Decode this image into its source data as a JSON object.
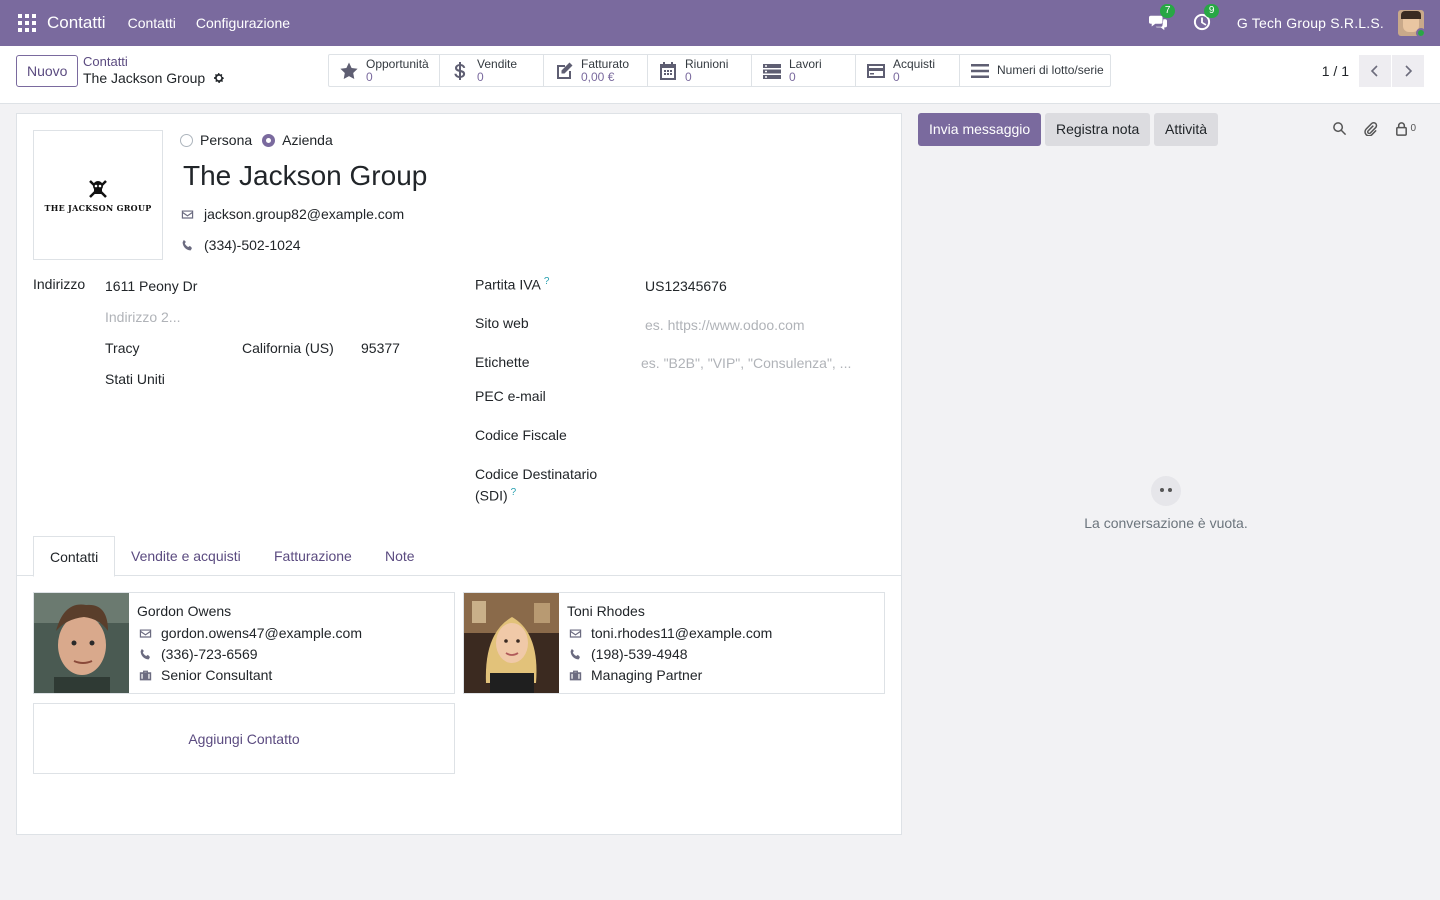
{
  "navbar": {
    "brand": "Contatti",
    "menu": [
      "Contatti",
      "Configurazione"
    ],
    "messages_count": "7",
    "activities_count": "9",
    "company": "G Tech Group S.R.L.S."
  },
  "control": {
    "new_label": "Nuovo",
    "breadcrumb_parent": "Contatti",
    "breadcrumb_current": "The Jackson Group",
    "pager": "1 / 1"
  },
  "smart_buttons": [
    {
      "label": "Opportunità",
      "value": "0",
      "icon": "star-icon"
    },
    {
      "label": "Vendite",
      "value": "0",
      "icon": "dollar-icon"
    },
    {
      "label": "Fatturato",
      "value": "0,00 €",
      "icon": "edit-icon"
    },
    {
      "label": "Riunioni",
      "value": "0",
      "icon": "calendar-icon"
    },
    {
      "label": "Lavori",
      "value": "0",
      "icon": "tasks-icon"
    },
    {
      "label": "Acquisti",
      "value": "0",
      "icon": "credit-card-icon"
    },
    {
      "label": "Numeri di lotto/serie",
      "value": "",
      "icon": "bars-icon"
    }
  ],
  "form": {
    "logo_text": "THE JACKSON GROUP",
    "type_person": "Persona",
    "type_company": "Azienda",
    "name": "The Jackson Group",
    "email": "jackson.group82@example.com",
    "phone": "(334)-502-1024",
    "address_label": "Indirizzo",
    "street": "1611 Peony Dr",
    "street2_placeholder": "Indirizzo 2...",
    "city": "Tracy",
    "state": "California (US)",
    "zip": "95377",
    "country": "Stati Uniti",
    "vat_label": "Partita IVA",
    "vat": "US12345676",
    "website_label": "Sito web",
    "website_placeholder": "es. https://www.odoo.com",
    "tags_label": "Etichette",
    "tags_placeholder": "es. \"B2B\", \"VIP\", \"Consulenza\", ...",
    "pec_label": "PEC e-mail",
    "fiscal_label": "Codice Fiscale",
    "sdi_label_1": "Codice Destinatario",
    "sdi_label_2": "(SDI)",
    "help_mark": "?"
  },
  "tabs": [
    "Contatti",
    "Vendite e acquisti",
    "Fatturazione",
    "Note"
  ],
  "contacts": [
    {
      "name": "Gordon Owens",
      "email": "gordon.owens47@example.com",
      "phone": "(336)-723-6569",
      "function": "Senior Consultant"
    },
    {
      "name": "Toni Rhodes",
      "email": "toni.rhodes11@example.com",
      "phone": "(198)-539-4948",
      "function": "Managing Partner"
    }
  ],
  "add_contact_label": "Aggiungi Contatto",
  "chatter": {
    "send_message": "Invia messaggio",
    "log_note": "Registra nota",
    "activities": "Attività",
    "followers_count": "0",
    "empty_message": "La conversazione è vuota."
  }
}
